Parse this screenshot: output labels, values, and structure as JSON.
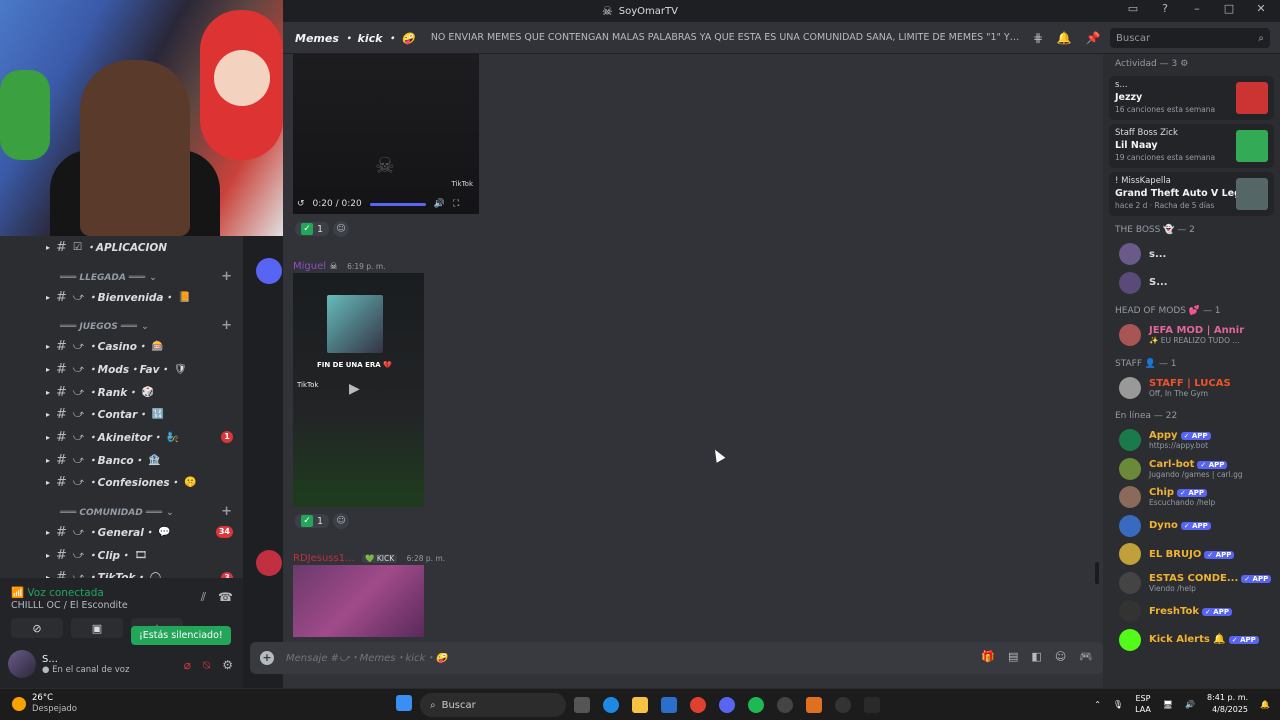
{
  "window": {
    "title": "SoyOmarTV"
  },
  "header": {
    "channel_name": "Memes ・ kick ・ 🤪",
    "topic": "NO ENVIAR MEMES QUE CONTENGAN MALAS PALABRAS YA QUE ESTA ES UNA COMUNIDAD SANA, LIMITE DE MEMES \"1\" Y POR ULTIMO EL ...",
    "search_placeholder": "Buscar"
  },
  "channels": [
    {
      "type": "channel",
      "label": "・APLICACION",
      "emoji": "",
      "prefix": "☑",
      "badge": ""
    },
    {
      "type": "category",
      "label": "═══ LLEGADA ═══"
    },
    {
      "type": "channel",
      "label": "・Bienvenida・",
      "emoji": "📙",
      "prefix": "⤻",
      "badge": ""
    },
    {
      "type": "category",
      "label": "═══ JUEGOS ═══"
    },
    {
      "type": "channel",
      "label": "・Casino・",
      "emoji": "🎰",
      "prefix": "⤻",
      "badge": ""
    },
    {
      "type": "channel",
      "label": "・Mods・Fav・",
      "emoji": "🛡",
      "prefix": "⤻",
      "badge": ""
    },
    {
      "type": "channel",
      "label": "・Rank・",
      "emoji": "🎲",
      "prefix": "⤻",
      "badge": ""
    },
    {
      "type": "channel",
      "label": "・Contar・",
      "emoji": "🔢",
      "prefix": "⤻",
      "badge": ""
    },
    {
      "type": "channel",
      "label": "・Akineitor・",
      "emoji": "🧞",
      "prefix": "⤻",
      "badge": "1"
    },
    {
      "type": "channel",
      "label": "・Banco・",
      "emoji": "🏦",
      "prefix": "⤻",
      "badge": ""
    },
    {
      "type": "channel",
      "label": "・Confesiones・",
      "emoji": "🤫",
      "prefix": "⤻",
      "badge": ""
    },
    {
      "type": "category",
      "label": "═══ COMUNIDAD ═══"
    },
    {
      "type": "channel",
      "label": "・General・",
      "emoji": "💬",
      "prefix": "⤻",
      "badge": "34"
    },
    {
      "type": "channel",
      "label": "・Clip・",
      "emoji": "🎞",
      "prefix": "⤻",
      "badge": ""
    },
    {
      "type": "channel",
      "label": "・TikTok・",
      "emoji": "◯",
      "prefix": "⤻",
      "badge": "3"
    }
  ],
  "voice": {
    "status": "Voz conectada",
    "channel": "CHILLL OC / El Escondite",
    "tooltip": "¡Estás silenciado!",
    "user_name": "S...",
    "user_status": "En el canal de voz"
  },
  "messages": [
    {
      "video_time": "0:20 / 0:20",
      "tiktok_label": "TikTok",
      "reaction_count": "1"
    },
    {
      "author": "Miguel",
      "author_color": "#8e4fc0",
      "author_badge": "☠",
      "time": "6:19 p. m.",
      "caption": "FIN DE UNA ERA 💔",
      "tiktok_label": "TikTok",
      "reaction_count": "1"
    },
    {
      "author": "RDJesuss1...",
      "author_color": "#c03040",
      "author_tag": "💚 KICK",
      "time": "6:28 p. m."
    }
  ],
  "composer": {
    "placeholder": "Mensaje #⤻・Memes・kick・🤪"
  },
  "members": {
    "activity_header": "Actividad — 3",
    "activities": [
      {
        "who": "s...",
        "what": "Jezzy",
        "sub": "16 canciones esta semana",
        "art_color": "#c33"
      },
      {
        "who": "Staff Boss Zick",
        "what": "Lil Naay",
        "sub": "19 canciones esta semana",
        "art_color": "#3a5"
      },
      {
        "who": "! MissKapella",
        "what": "Grand Theft Auto V Legacy",
        "sub": "hace 2 d  ·  Racha de 5 días",
        "art_color": "#566"
      }
    ],
    "groups": [
      {
        "title": "THE BOSS 👻 — 2",
        "members": [
          {
            "name": "s...",
            "status": "",
            "color": "#dbdee1",
            "app": false,
            "av": "#6a5a8a"
          },
          {
            "name": "S...",
            "status": "",
            "color": "#dbdee1",
            "app": false,
            "av": "#5a4a7a"
          }
        ]
      },
      {
        "title": "HEAD OF MODS 💕 — 1",
        "members": [
          {
            "name": "JEFA MOD | Annir",
            "status": "✨ EU REALIZO TUDO ...",
            "color": "#e0679c",
            "app": false,
            "av": "#a55"
          }
        ]
      },
      {
        "title": "STAFF 👤 — 1",
        "members": [
          {
            "name": "STAFF | LUCAS",
            "status": "Off, In The Gym",
            "color": "#f0522a",
            "app": false,
            "av": "#999"
          }
        ]
      },
      {
        "title": "En línea — 22",
        "members": [
          {
            "name": "Appy",
            "status": "https://appy.bot",
            "color": "#f0b232",
            "app": true,
            "av": "#1a7a4a"
          },
          {
            "name": "Carl-bot",
            "status": "Jugando /games | carl.gg",
            "color": "#f0b232",
            "app": true,
            "av": "#6a8a3a"
          },
          {
            "name": "Chip",
            "status": "Escuchando /help",
            "color": "#f0b232",
            "app": true,
            "av": "#8a6a5a"
          },
          {
            "name": "Dyno",
            "status": "",
            "color": "#f0b232",
            "app": true,
            "av": "#3a6ac0"
          },
          {
            "name": "EL BRUJO",
            "status": "",
            "color": "#f0b232",
            "app": true,
            "av": "#c0a03a"
          },
          {
            "name": "ESTAS CONDE...",
            "status": "Viendo /help",
            "color": "#f0b232",
            "app": true,
            "av": "#444"
          },
          {
            "name": "FreshTok",
            "status": "",
            "color": "#f0b232",
            "app": true,
            "av": "#333"
          },
          {
            "name": "Kick Alerts 🔔",
            "status": "",
            "color": "#f0b232",
            "app": true,
            "av": "#53fc18"
          }
        ]
      }
    ]
  },
  "taskbar": {
    "temp": "26°C",
    "weather": "Despejado",
    "search": "Buscar",
    "lang": "ESP",
    "lang2": "LAA",
    "time": "8:41 p. m.",
    "date": "4/8/2025"
  }
}
